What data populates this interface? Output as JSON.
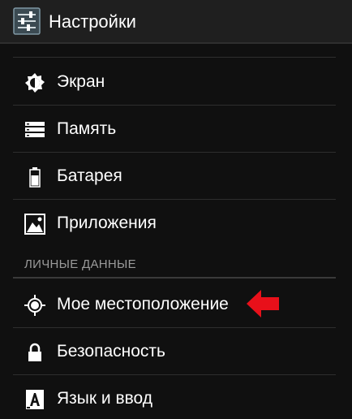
{
  "header": {
    "title": "Настройки",
    "icon": "settings-sliders-icon"
  },
  "items": [
    {
      "label": "Экран",
      "icon": "brightness-icon"
    },
    {
      "label": "Память",
      "icon": "storage-icon"
    },
    {
      "label": "Батарея",
      "icon": "battery-icon"
    },
    {
      "label": "Приложения",
      "icon": "apps-icon"
    }
  ],
  "personal_section": {
    "header": "ЛИЧНЫЕ ДАННЫЕ",
    "items": [
      {
        "label": "Мое местоположение",
        "icon": "location-icon"
      },
      {
        "label": "Безопасность",
        "icon": "lock-icon"
      },
      {
        "label": "Язык и ввод",
        "icon": "keyboard-language-icon"
      }
    ]
  },
  "colors": {
    "background": "#101010",
    "text": "#ffffff",
    "section_header": "#9a9a9a",
    "annotation_arrow": "#e8101a"
  }
}
